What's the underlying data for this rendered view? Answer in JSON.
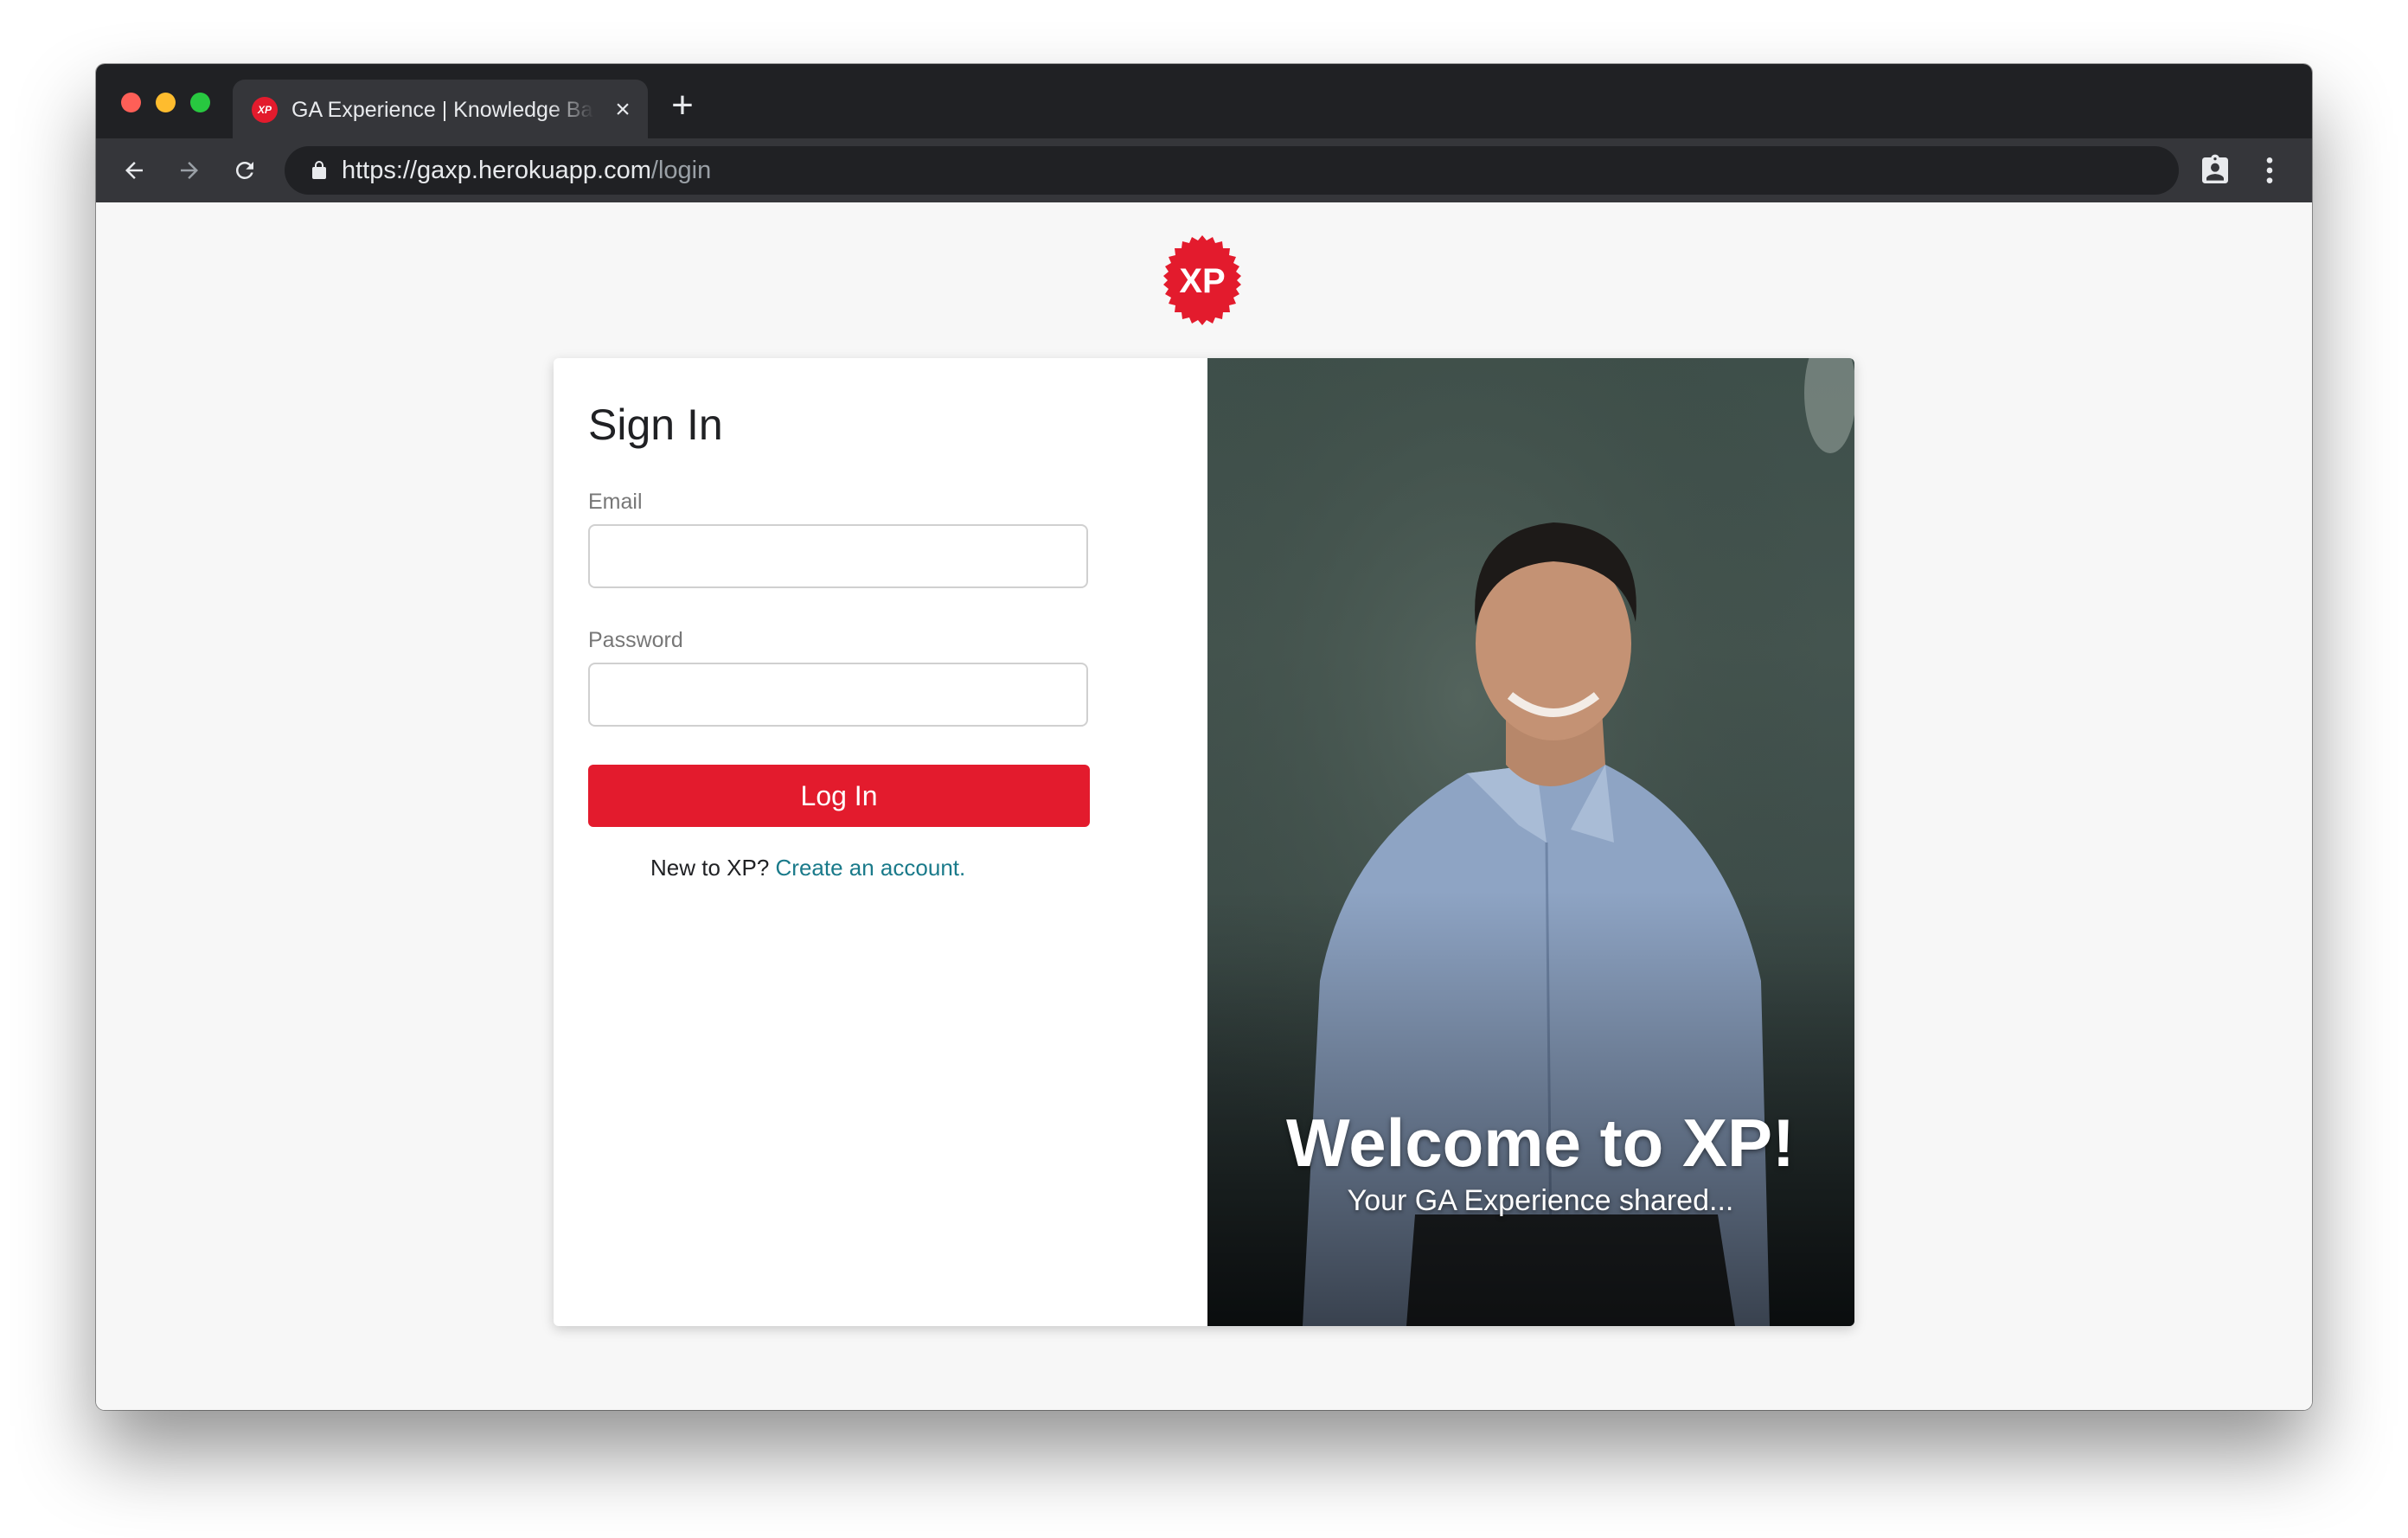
{
  "browser": {
    "tab_title": "GA Experience | Knowledge Base",
    "tab_favicon_text": "XP",
    "url_main": "https://gaxp.herokuapp.com",
    "url_path": "/login"
  },
  "brand": {
    "logo_text": "XP",
    "accent_color": "#e31b2d",
    "link_color": "#1a7a8a"
  },
  "login": {
    "title": "Sign In",
    "email_label": "Email",
    "email_value": "",
    "password_label": "Password",
    "password_value": "",
    "submit_label": "Log In",
    "signup_prompt": "New to XP?",
    "signup_link": "Create an account."
  },
  "hero": {
    "heading": "Welcome to XP!",
    "subheading": "Your GA Experience shared..."
  }
}
